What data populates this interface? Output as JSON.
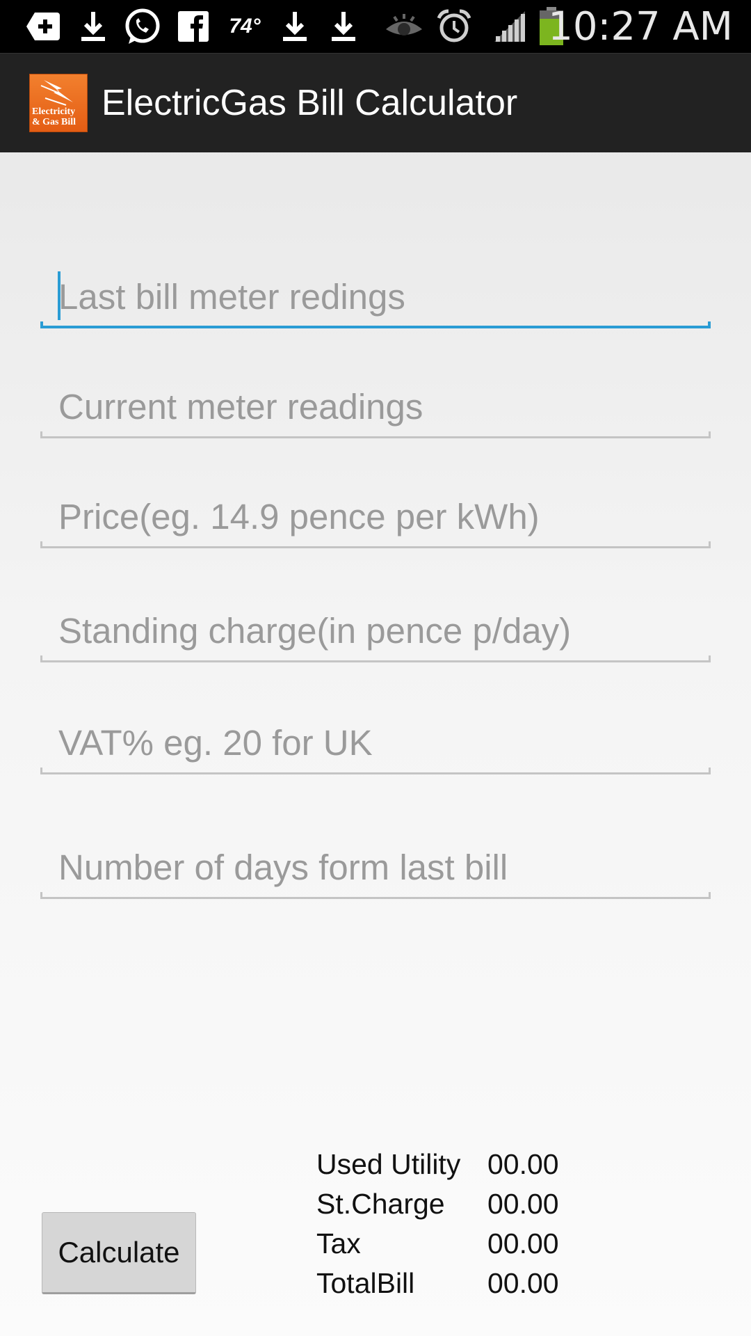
{
  "status_bar": {
    "time": "10:27 AM",
    "temperature": "74°",
    "icons": [
      "add-box-icon",
      "download-icon",
      "whatsapp-icon",
      "facebook-icon",
      "weather-temp",
      "download-icon",
      "download-icon",
      "eye-icon",
      "alarm-icon",
      "signal-icon",
      "battery-icon"
    ],
    "battery_color": "#7cb51f"
  },
  "action_bar": {
    "title": "ElectricGas Bill Calculator",
    "logo_text_line1": "Electricity",
    "logo_text_line2": "& Gas Bill",
    "logo_color": "#ee7424"
  },
  "form": {
    "fields": [
      {
        "placeholder": "Last bill meter redings",
        "focused": true
      },
      {
        "placeholder": "Current meter readings"
      },
      {
        "placeholder": "Price(eg. 14.9 pence per kWh)"
      },
      {
        "placeholder": "Standing charge(in pence p/day)"
      },
      {
        "placeholder": "VAT% eg. 20 for UK"
      },
      {
        "placeholder": "Number of days form last bill"
      }
    ],
    "accent_color": "#2a9cd4"
  },
  "calculate_label": "Calculate",
  "results": [
    {
      "label": "Used Utility",
      "value": "00.00"
    },
    {
      "label": "St.Charge",
      "value": "00.00"
    },
    {
      "label": "Tax",
      "value": "00.00"
    },
    {
      "label": "TotalBill",
      "value": "00.00"
    }
  ]
}
